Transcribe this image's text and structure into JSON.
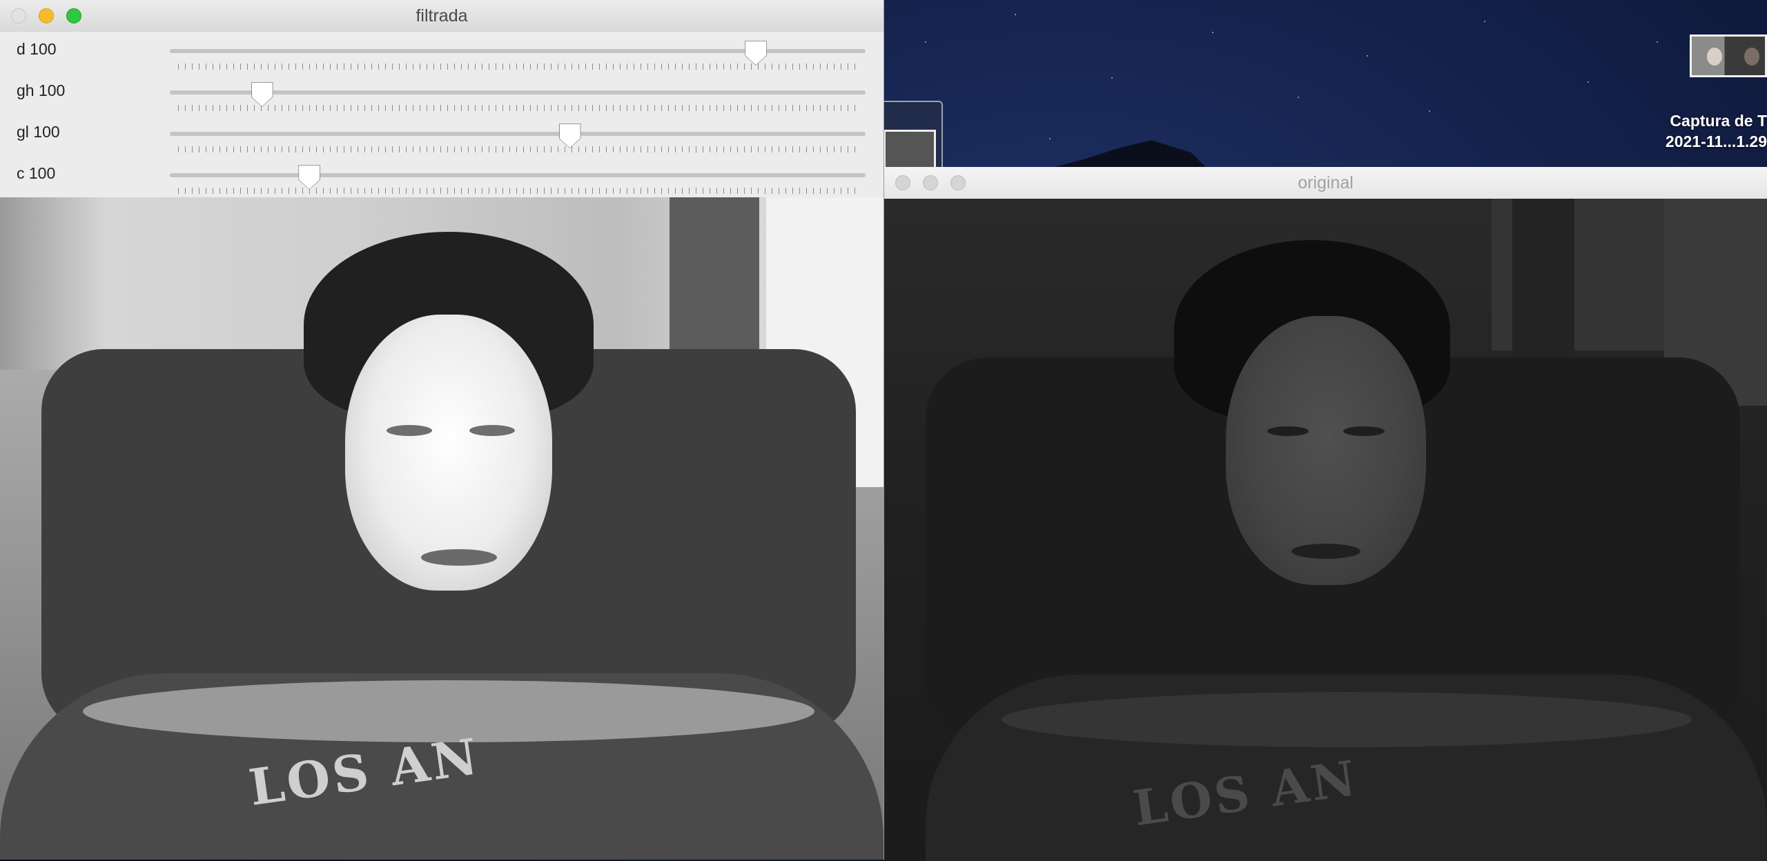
{
  "desktop": {
    "file_label_line1": "Captura de T",
    "file_label_line2": "2021-11...1.29"
  },
  "filtrada_window": {
    "title": "filtrada",
    "sliders": [
      {
        "label": "d 100",
        "value_fraction": 0.85
      },
      {
        "label": "gh 100",
        "value_fraction": 0.12
      },
      {
        "label": "gl 100",
        "value_fraction": 0.575
      },
      {
        "label": "c 100",
        "value_fraction": 0.19
      }
    ],
    "image": "filtered grayscale webcam frame (bright)",
    "shirt_text": "LOS AN"
  },
  "original_window": {
    "title": "original",
    "image": "original grayscale webcam frame (dark)",
    "shirt_text": "LOS AN"
  },
  "colors": {
    "desktop_sky": "#0f1a3d",
    "titlebar": "#e0e0e0",
    "close_light": "#e2e2e2",
    "minimize_light": "#f7bb2a",
    "maximize_light": "#2fc840"
  }
}
